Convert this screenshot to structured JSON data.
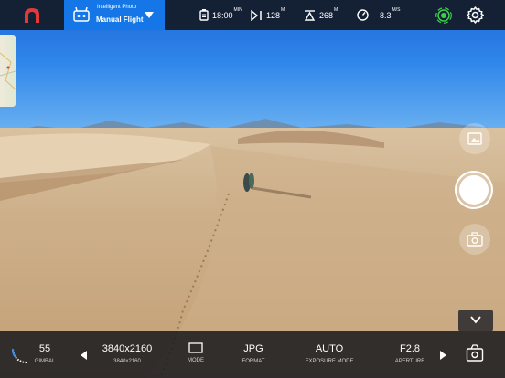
{
  "topbar": {
    "mode_subtitle": "Intelligent Photo",
    "mode_title": "Manual Flight",
    "flight_time": "18:00",
    "flight_time_unit": "MIN",
    "distance": "128",
    "distance_unit": "M",
    "altitude": "268",
    "altitude_unit": "M",
    "speed": "8.3",
    "speed_unit": "M/S"
  },
  "bottombar": {
    "gimbal_value": "55",
    "gimbal_label": "GIMBAL",
    "resolution_value": "3840x2160",
    "resolution_label": "3840x2160",
    "mode_label": "MODE",
    "format_value": "JPG",
    "format_label": "FORMAT",
    "exposure_value": "AUTO",
    "exposure_label": "EXPOSURE MODE",
    "aperture_value": "F2.8",
    "aperture_label": "APERTURE"
  },
  "colors": {
    "accent": "#1576e8",
    "logo": "#e03a3a",
    "signal": "#3ecf4a"
  }
}
